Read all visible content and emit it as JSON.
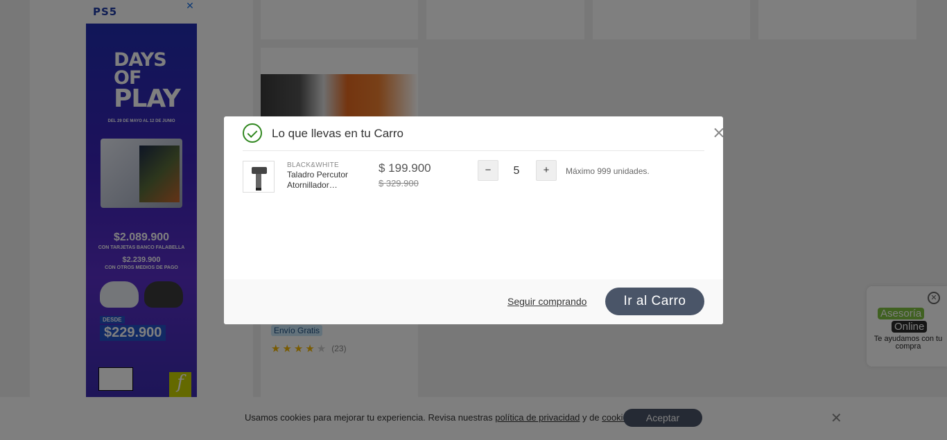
{
  "ad": {
    "brand": "PS5",
    "title_line1": "DAYS OF",
    "title_line2": "PLAY",
    "dates": "DEL 29 DE MAYO AL 12 DE JUNIO",
    "price_main": "$2.089.900",
    "price_main_note": "CON TARJETAS BANCO FALABELLA",
    "price_other": "$2.239.900",
    "price_other_note": "CON OTROS MEDIOS DE PAGO",
    "desde_label": "DESDE",
    "desde_price": "$229.900",
    "close_glyph": "✕",
    "f_glyph": "f"
  },
  "background_product": {
    "shipping_badge": "Envío Gratis",
    "rating": 4,
    "review_count": "(23)"
  },
  "modal": {
    "title": "Lo que llevas en tu Carro",
    "item": {
      "brand": "BLACK&WHITE",
      "name": "Taladro Percutor Atornillador…",
      "price": "$ 199.900",
      "old_price": "$ 329.900",
      "quantity": "5",
      "minus_glyph": "−",
      "plus_glyph": "+",
      "max_note": "Máximo 999 unidades."
    },
    "continue_label": "Seguir comprando",
    "go_cart_label": "Ir al Carro"
  },
  "cookies": {
    "text_before": "Usamos cookies para mejorar tu experiencia. Revisa nuestras ",
    "privacy_link": "política de privacidad",
    "text_middle": " y de ",
    "cookies_link": "cookies",
    "text_after": ".",
    "accept_label": "Aceptar",
    "close_glyph": "✕"
  },
  "asesoria": {
    "line1": "Asesoría",
    "line2": "Online",
    "text": "Te ayudamos con tu compra",
    "close_glyph": "✕"
  },
  "colors": {
    "primary_button": "#4a5568",
    "success_green": "#30871f",
    "star": "#f2b705"
  }
}
